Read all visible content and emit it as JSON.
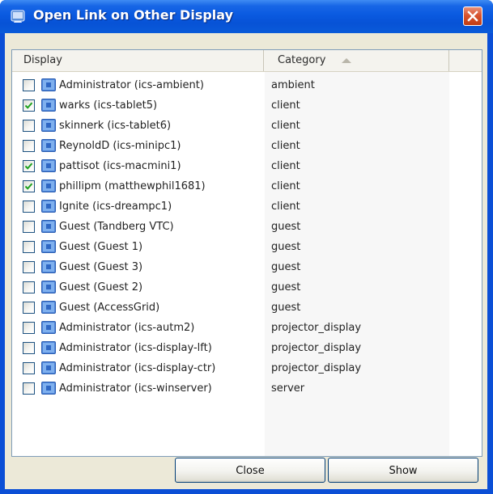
{
  "window": {
    "title": "Open Link on Other Display",
    "icon": "app-window-icon",
    "close_icon": "close-x-icon"
  },
  "list": {
    "columns": [
      "Display",
      "Category"
    ],
    "sort_column": "Category",
    "sort_direction": "ascending",
    "rows": [
      {
        "display": "Administrator (ics-ambient)",
        "category": "ambient",
        "checked": false
      },
      {
        "display": "warks (ics-tablet5)",
        "category": "client",
        "checked": true
      },
      {
        "display": "skinnerk (ics-tablet6)",
        "category": "client",
        "checked": false
      },
      {
        "display": "ReynoldD (ics-minipc1)",
        "category": "client",
        "checked": false
      },
      {
        "display": "pattisot (ics-macmini1)",
        "category": "client",
        "checked": true
      },
      {
        "display": "phillipm (matthewphil1681)",
        "category": "client",
        "checked": true
      },
      {
        "display": "Ignite (ics-dreampc1)",
        "category": "client",
        "checked": false
      },
      {
        "display": "Guest (Tandberg VTC)",
        "category": "guest",
        "checked": false
      },
      {
        "display": "Guest (Guest 1)",
        "category": "guest",
        "checked": false
      },
      {
        "display": "Guest (Guest 3)",
        "category": "guest",
        "checked": false
      },
      {
        "display": "Guest (Guest 2)",
        "category": "guest",
        "checked": false
      },
      {
        "display": "Guest (AccessGrid)",
        "category": "guest",
        "checked": false
      },
      {
        "display": "Administrator (ics-autm2)",
        "category": "projector_display",
        "checked": false
      },
      {
        "display": "Administrator (ics-display-lft)",
        "category": "projector_display",
        "checked": false
      },
      {
        "display": "Administrator (ics-display-ctr)",
        "category": "projector_display",
        "checked": false
      },
      {
        "display": "Administrator (ics-winserver)",
        "category": "server",
        "checked": false
      }
    ]
  },
  "buttons": {
    "close_label": "Close",
    "show_label": "Show"
  },
  "colors": {
    "title_bar": "#0a5ae0",
    "dialog_bg": "#ece9d8",
    "checkbox_border": "#1c5180",
    "check_mark": "#21a121"
  }
}
